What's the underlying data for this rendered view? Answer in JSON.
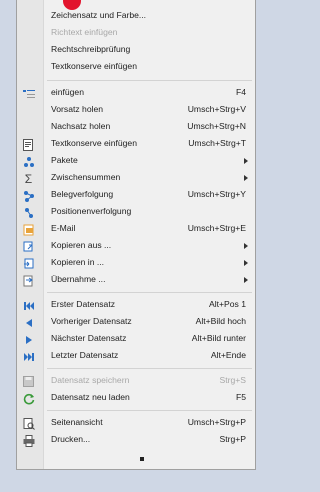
{
  "menu": {
    "items": [
      {
        "label": "Zeichensatz und Farbe...",
        "shortcut": "",
        "disabled": false,
        "submenu": false,
        "icon": ""
      },
      {
        "label": "Richtext einfügen",
        "shortcut": "",
        "disabled": true,
        "submenu": false,
        "icon": ""
      },
      {
        "label": "Rechtschreibprüfung",
        "shortcut": "",
        "disabled": false,
        "submenu": false,
        "icon": ""
      },
      {
        "label": "Textkonserve einfügen",
        "shortcut": "",
        "disabled": false,
        "submenu": false,
        "icon": ""
      },
      {
        "label": "einfügen",
        "shortcut": "F4",
        "disabled": false,
        "submenu": false,
        "icon": "insert-list-icon"
      },
      {
        "label": "Vorsatz holen",
        "shortcut": "Umsch+Strg+V",
        "disabled": false,
        "submenu": false,
        "icon": ""
      },
      {
        "label": "Nachsatz holen",
        "shortcut": "Umsch+Strg+N",
        "disabled": false,
        "submenu": false,
        "icon": ""
      },
      {
        "label": "Textkonserve einfügen",
        "shortcut": "Umsch+Strg+T",
        "disabled": false,
        "submenu": false,
        "icon": "text-template-icon"
      },
      {
        "label": "Pakete",
        "shortcut": "",
        "disabled": false,
        "submenu": true,
        "icon": "package-icon"
      },
      {
        "label": "Zwischensummen",
        "shortcut": "",
        "disabled": false,
        "submenu": true,
        "icon": "sigma-icon"
      },
      {
        "label": "Belegverfolgung",
        "shortcut": "Umsch+Strg+Y",
        "disabled": false,
        "submenu": false,
        "icon": "document-tracking-icon"
      },
      {
        "label": "Positionenverfolgung",
        "shortcut": "",
        "disabled": false,
        "submenu": false,
        "icon": "position-tracking-icon"
      },
      {
        "label": "E-Mail",
        "shortcut": "Umsch+Strg+E",
        "disabled": false,
        "submenu": false,
        "icon": "email-icon"
      },
      {
        "label": "Kopieren aus ...",
        "shortcut": "",
        "disabled": false,
        "submenu": true,
        "icon": "copy-from-icon"
      },
      {
        "label": "Kopieren in ...",
        "shortcut": "",
        "disabled": false,
        "submenu": true,
        "icon": "copy-to-icon"
      },
      {
        "label": "Übernahme ...",
        "shortcut": "",
        "disabled": false,
        "submenu": true,
        "icon": "takeover-icon"
      },
      {
        "label": "Erster Datensatz",
        "shortcut": "Alt+Pos 1",
        "disabled": false,
        "submenu": false,
        "icon": "first-record-icon"
      },
      {
        "label": "Vorheriger Datensatz",
        "shortcut": "Alt+Bild hoch",
        "disabled": false,
        "submenu": false,
        "icon": "previous-record-icon"
      },
      {
        "label": "Nächster Datensatz",
        "shortcut": "Alt+Bild runter",
        "disabled": false,
        "submenu": false,
        "icon": "next-record-icon"
      },
      {
        "label": "Letzter Datensatz",
        "shortcut": "Alt+Ende",
        "disabled": false,
        "submenu": false,
        "icon": "last-record-icon"
      },
      {
        "label": "Datensatz speichern",
        "shortcut": "Strg+S",
        "disabled": true,
        "submenu": false,
        "icon": "save-icon"
      },
      {
        "label": "Datensatz neu laden",
        "shortcut": "F5",
        "disabled": false,
        "submenu": false,
        "icon": "reload-icon"
      },
      {
        "label": "Seitenansicht",
        "shortcut": "Umsch+Strg+P",
        "disabled": false,
        "submenu": false,
        "icon": "print-preview-icon"
      },
      {
        "label": "Drucken...",
        "shortcut": "Strg+P",
        "disabled": false,
        "submenu": false,
        "icon": "printer-icon"
      }
    ]
  },
  "colors": {
    "blue": "#2b6fc4",
    "green": "#3a9a3a",
    "orange": "#e8a33a",
    "record_indicator": "#e2142d"
  }
}
